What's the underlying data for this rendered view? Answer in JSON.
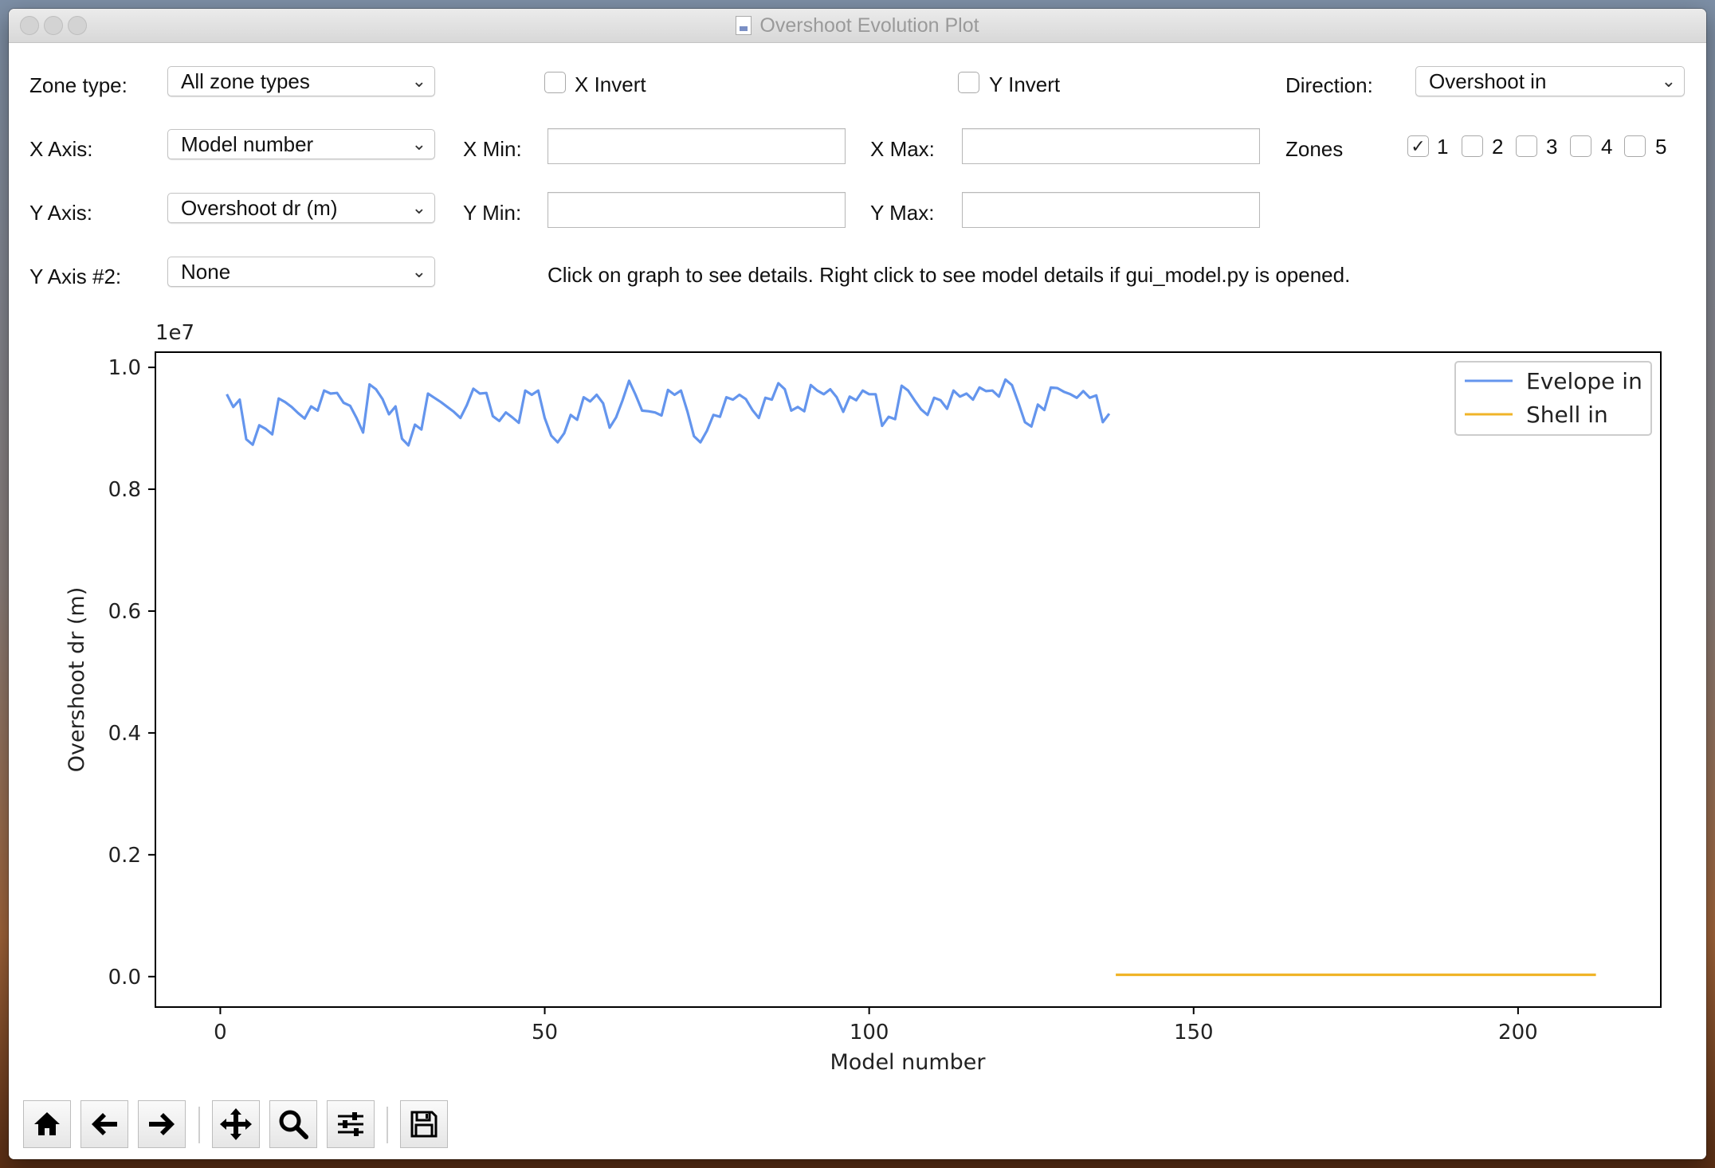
{
  "window": {
    "title": "Overshoot Evolution Plot"
  },
  "controls": {
    "zone_type_label": "Zone type:",
    "zone_type_value": "All zone types",
    "x_invert_label": "X Invert",
    "y_invert_label": "Y Invert",
    "direction_label": "Direction:",
    "direction_value": "Overshoot in",
    "x_axis_label": "X Axis:",
    "x_axis_value": "Model number",
    "x_min_label": "X Min:",
    "x_max_label": "X Max:",
    "zones_label": "Zones",
    "zones": [
      {
        "label": "1",
        "checked": true
      },
      {
        "label": "2",
        "checked": false
      },
      {
        "label": "3",
        "checked": false
      },
      {
        "label": "4",
        "checked": false
      },
      {
        "label": "5",
        "checked": false
      }
    ],
    "y_axis_label": "Y Axis:",
    "y_axis_value": "Overshoot dr (m)",
    "y_min_label": "Y Min:",
    "y_max_label": "Y Max:",
    "y_axis2_label": "Y Axis #2:",
    "y_axis2_value": "None",
    "hint": "Click on graph to see details. Right click to see model details if gui_model.py is opened."
  },
  "toolbar": [
    "home-icon",
    "back-arrow-icon",
    "forward-arrow-icon",
    "pan-icon",
    "zoom-icon",
    "configure-subplots-icon",
    "save-icon"
  ],
  "chart_data": {
    "type": "line",
    "xlabel": "Model number",
    "ylabel": "Overshoot dr (m)",
    "y_offset_text": "1e7",
    "xlim": [
      -10,
      222
    ],
    "ylim": [
      -0.05,
      1.025
    ],
    "xticks": [
      0,
      50,
      100,
      150,
      200
    ],
    "yticks": [
      0.0,
      0.2,
      0.4,
      0.6,
      0.8,
      1.0
    ],
    "ytick_labels": [
      "0.0",
      "0.2",
      "0.4",
      "0.6",
      "0.8",
      "1.0"
    ],
    "legend_position": "top-right",
    "series": [
      {
        "name": "Evelope in",
        "color": "#6495ed",
        "x": [
          1,
          2,
          3,
          4,
          5,
          6,
          7,
          8,
          9,
          10,
          11,
          12,
          13,
          14,
          15,
          16,
          17,
          18,
          19,
          20,
          21,
          22,
          23,
          24,
          25,
          26,
          27,
          28,
          29,
          30,
          31,
          32,
          33,
          34,
          35,
          36,
          37,
          38,
          39,
          40,
          41,
          42,
          43,
          44,
          45,
          46,
          47,
          48,
          49,
          50,
          51,
          52,
          53,
          54,
          55,
          56,
          57,
          58,
          59,
          60,
          61,
          62,
          63,
          64,
          65,
          66,
          67,
          68,
          69,
          70,
          71,
          72,
          73,
          74,
          75,
          76,
          77,
          78,
          79,
          80,
          81,
          82,
          83,
          84,
          85,
          86,
          87,
          88,
          89,
          90,
          91,
          92,
          93,
          94,
          95,
          96,
          97,
          98,
          99,
          100,
          101,
          102,
          103,
          104,
          105,
          106,
          107,
          108,
          109,
          110,
          111,
          112,
          113,
          114,
          115,
          116,
          117,
          118,
          119,
          120,
          121,
          122,
          123,
          124,
          125,
          126,
          127,
          128,
          129,
          130,
          131,
          132,
          133,
          134,
          135,
          136,
          137
        ],
        "y": [
          0.956,
          0.935,
          0.947,
          0.882,
          0.873,
          0.905,
          0.899,
          0.89,
          0.949,
          0.943,
          0.935,
          0.925,
          0.916,
          0.936,
          0.929,
          0.962,
          0.957,
          0.958,
          0.942,
          0.937,
          0.917,
          0.893,
          0.972,
          0.964,
          0.948,
          0.923,
          0.936,
          0.883,
          0.872,
          0.906,
          0.898,
          0.957,
          0.95,
          0.943,
          0.935,
          0.927,
          0.917,
          0.938,
          0.965,
          0.957,
          0.958,
          0.92,
          0.912,
          0.926,
          0.918,
          0.909,
          0.962,
          0.955,
          0.962,
          0.917,
          0.888,
          0.877,
          0.892,
          0.922,
          0.914,
          0.951,
          0.944,
          0.955,
          0.941,
          0.901,
          0.918,
          0.946,
          0.978,
          0.955,
          0.929,
          0.928,
          0.926,
          0.921,
          0.963,
          0.955,
          0.962,
          0.927,
          0.887,
          0.877,
          0.896,
          0.922,
          0.919,
          0.951,
          0.947,
          0.955,
          0.948,
          0.93,
          0.917,
          0.95,
          0.947,
          0.974,
          0.964,
          0.929,
          0.935,
          0.928,
          0.971,
          0.962,
          0.956,
          0.964,
          0.951,
          0.927,
          0.952,
          0.946,
          0.962,
          0.956,
          0.956,
          0.904,
          0.919,
          0.915,
          0.97,
          0.962,
          0.946,
          0.931,
          0.922,
          0.95,
          0.946,
          0.932,
          0.962,
          0.952,
          0.957,
          0.947,
          0.967,
          0.961,
          0.962,
          0.952,
          0.98,
          0.971,
          0.942,
          0.91,
          0.903,
          0.939,
          0.93,
          0.967,
          0.966,
          0.96,
          0.956,
          0.95,
          0.961,
          0.95,
          0.954,
          0.91,
          0.924
        ]
      },
      {
        "name": "Shell in",
        "color": "#f0b428",
        "x": [
          138,
          212
        ],
        "y": [
          0.003,
          0.003
        ]
      }
    ]
  }
}
